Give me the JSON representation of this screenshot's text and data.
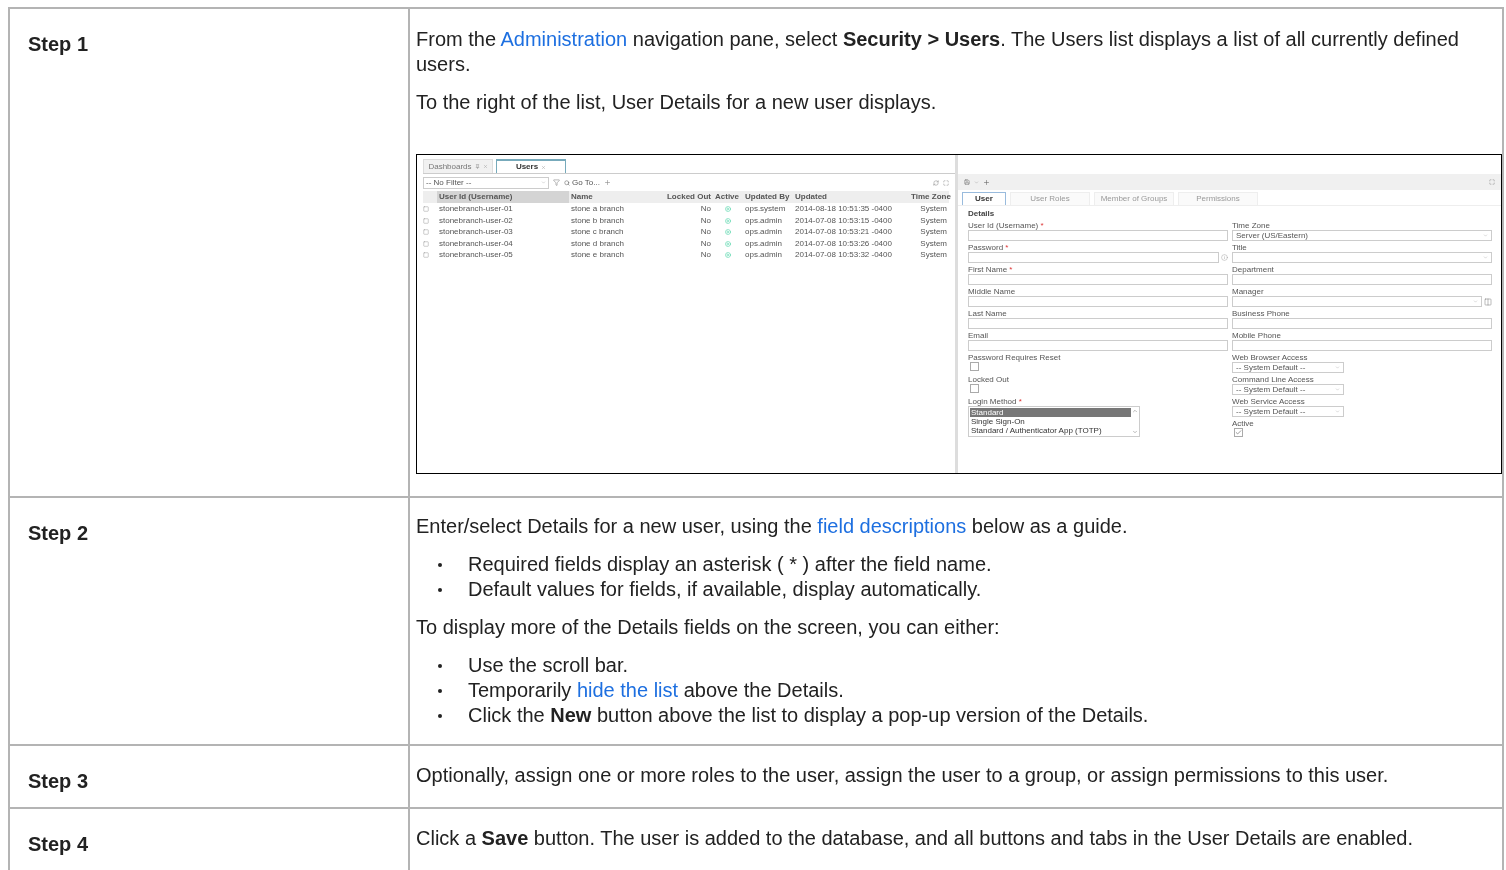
{
  "steps": [
    {
      "label": "Step 1",
      "content": [
        {
          "kind": "paragraph",
          "parts": [
            {
              "kind": "text",
              "text": "From the "
            },
            {
              "kind": "link",
              "text": "Administration"
            },
            {
              "kind": "text",
              "text": " navigation pane, select **Security > Users**. The Users list displays a list of all currently defined users."
            }
          ]
        },
        {
          "kind": "paragraph",
          "parts": [
            {
              "kind": "text",
              "text": "To the right of the list, User Details for a new user displays."
            }
          ]
        },
        {
          "kind": "screenshot"
        }
      ]
    },
    {
      "label": "Step 2",
      "content": [
        {
          "kind": "paragraph",
          "parts": [
            {
              "kind": "text",
              "text": "Enter/select Details for a new user, using the "
            },
            {
              "kind": "link",
              "text": "field descriptions"
            },
            {
              "kind": "text",
              "text": " below as a guide."
            }
          ]
        },
        {
          "kind": "bullets",
          "items": [
            [
              {
                "kind": "text",
                "text": "Required fields display an asterisk ( * ) after the field name."
              }
            ],
            [
              {
                "kind": "text",
                "text": "Default values for fields, if available, display automatically."
              }
            ]
          ]
        },
        {
          "kind": "paragraph",
          "parts": [
            {
              "kind": "text",
              "text": "To display more of the Details fields on the screen, you can either:"
            }
          ]
        },
        {
          "kind": "bullets",
          "items": [
            [
              {
                "kind": "text",
                "text": "Use the scroll bar."
              }
            ],
            [
              {
                "kind": "text",
                "text": "Temporarily "
              },
              {
                "kind": "link",
                "text": "hide the list"
              },
              {
                "kind": "text",
                "text": " above the Details."
              }
            ],
            [
              {
                "kind": "text",
                "text": "Click the **New** button above the list to display a pop-up version of the Details."
              }
            ]
          ]
        }
      ]
    },
    {
      "label": "Step 3",
      "content": [
        {
          "kind": "paragraph",
          "parts": [
            {
              "kind": "text",
              "text": "Optionally, assign one or more roles to the user, assign the user to a group, or assign permissions to this user."
            }
          ]
        }
      ]
    },
    {
      "label": "Step 4",
      "content": [
        {
          "kind": "paragraph",
          "parts": [
            {
              "kind": "text",
              "text": "Click a **Save** button. The user is added to the database, and all buttons and tabs in the User Details are enabled."
            }
          ]
        }
      ]
    }
  ],
  "screenshot": {
    "tabs": [
      {
        "label": "Dashboards",
        "selected": false
      },
      {
        "label": "Users",
        "selected": true
      }
    ],
    "filter": {
      "value": "-- No Filter --"
    },
    "goto": "Go To...",
    "columns": [
      "User Id (Username)",
      "Name",
      "Locked Out",
      "Active",
      "Updated By",
      "Updated",
      "Time Zone"
    ],
    "rows": [
      {
        "user": "stonebranch-user-01",
        "name": "stone a branch",
        "locked_out": "No",
        "active": true,
        "updated_by": "ops.system",
        "updated": "2014-08-18 10:51:35 -0400",
        "time_zone": "System"
      },
      {
        "user": "stonebranch-user-02",
        "name": "stone b branch",
        "locked_out": "No",
        "active": true,
        "updated_by": "ops.admin",
        "updated": "2014-07-08 10:53:15 -0400",
        "time_zone": "System"
      },
      {
        "user": "stonebranch-user-03",
        "name": "stone c branch",
        "locked_out": "No",
        "active": true,
        "updated_by": "ops.admin",
        "updated": "2014-07-08 10:53:21 -0400",
        "time_zone": "System"
      },
      {
        "user": "stonebranch-user-04",
        "name": "stone d branch",
        "locked_out": "No",
        "active": true,
        "updated_by": "ops.admin",
        "updated": "2014-07-08 10:53:26 -0400",
        "time_zone": "System"
      },
      {
        "user": "stonebranch-user-05",
        "name": "stone e branch",
        "locked_out": "No",
        "active": true,
        "updated_by": "ops.admin",
        "updated": "2014-07-08 10:53:32 -0400",
        "time_zone": "System"
      }
    ],
    "detail_tabs": [
      {
        "label": "User",
        "selected": true
      },
      {
        "label": "User Roles",
        "selected": false
      },
      {
        "label": "Member of Groups",
        "selected": false
      },
      {
        "label": "Permissions",
        "selected": false
      }
    ],
    "section": "Details",
    "left_fields": [
      {
        "kind": "text",
        "label": "User Id (Username)",
        "mark": "*"
      },
      {
        "kind": "password",
        "label": "Password",
        "mark": "*"
      },
      {
        "kind": "text",
        "label": "First Name",
        "mark": "*"
      },
      {
        "kind": "text",
        "label": "Middle Name"
      },
      {
        "kind": "text",
        "label": "Last Name"
      },
      {
        "kind": "text",
        "label": "Email"
      },
      {
        "kind": "checkbox",
        "label": "Password Requires Reset",
        "checked": false
      },
      {
        "kind": "checkbox",
        "label": "Locked Out",
        "checked": false
      },
      {
        "kind": "listbox",
        "label": "Login Method",
        "mark": "*",
        "options": [
          {
            "label": "Standard",
            "selected": true
          },
          {
            "label": "Single Sign-On",
            "selected": false
          },
          {
            "label": "Standard / Authenticator App (TOTP)",
            "selected": false
          }
        ]
      }
    ],
    "right_fields": [
      {
        "kind": "select",
        "label": "Time Zone",
        "value": "Server (US/Eastern)"
      },
      {
        "kind": "select",
        "label": "Title"
      },
      {
        "kind": "text",
        "label": "Department"
      },
      {
        "kind": "lookup",
        "label": "Manager"
      },
      {
        "kind": "text",
        "label": "Business Phone"
      },
      {
        "kind": "text",
        "label": "Mobile Phone"
      },
      {
        "kind": "small_select",
        "label": "Web Browser Access",
        "value": "-- System Default --"
      },
      {
        "kind": "small_select",
        "label": "Command Line Access",
        "value": "-- System Default --"
      },
      {
        "kind": "small_select",
        "label": "Web Service Access",
        "value": "-- System Default --"
      },
      {
        "kind": "checkbox",
        "label": "Active",
        "checked": true
      }
    ]
  }
}
